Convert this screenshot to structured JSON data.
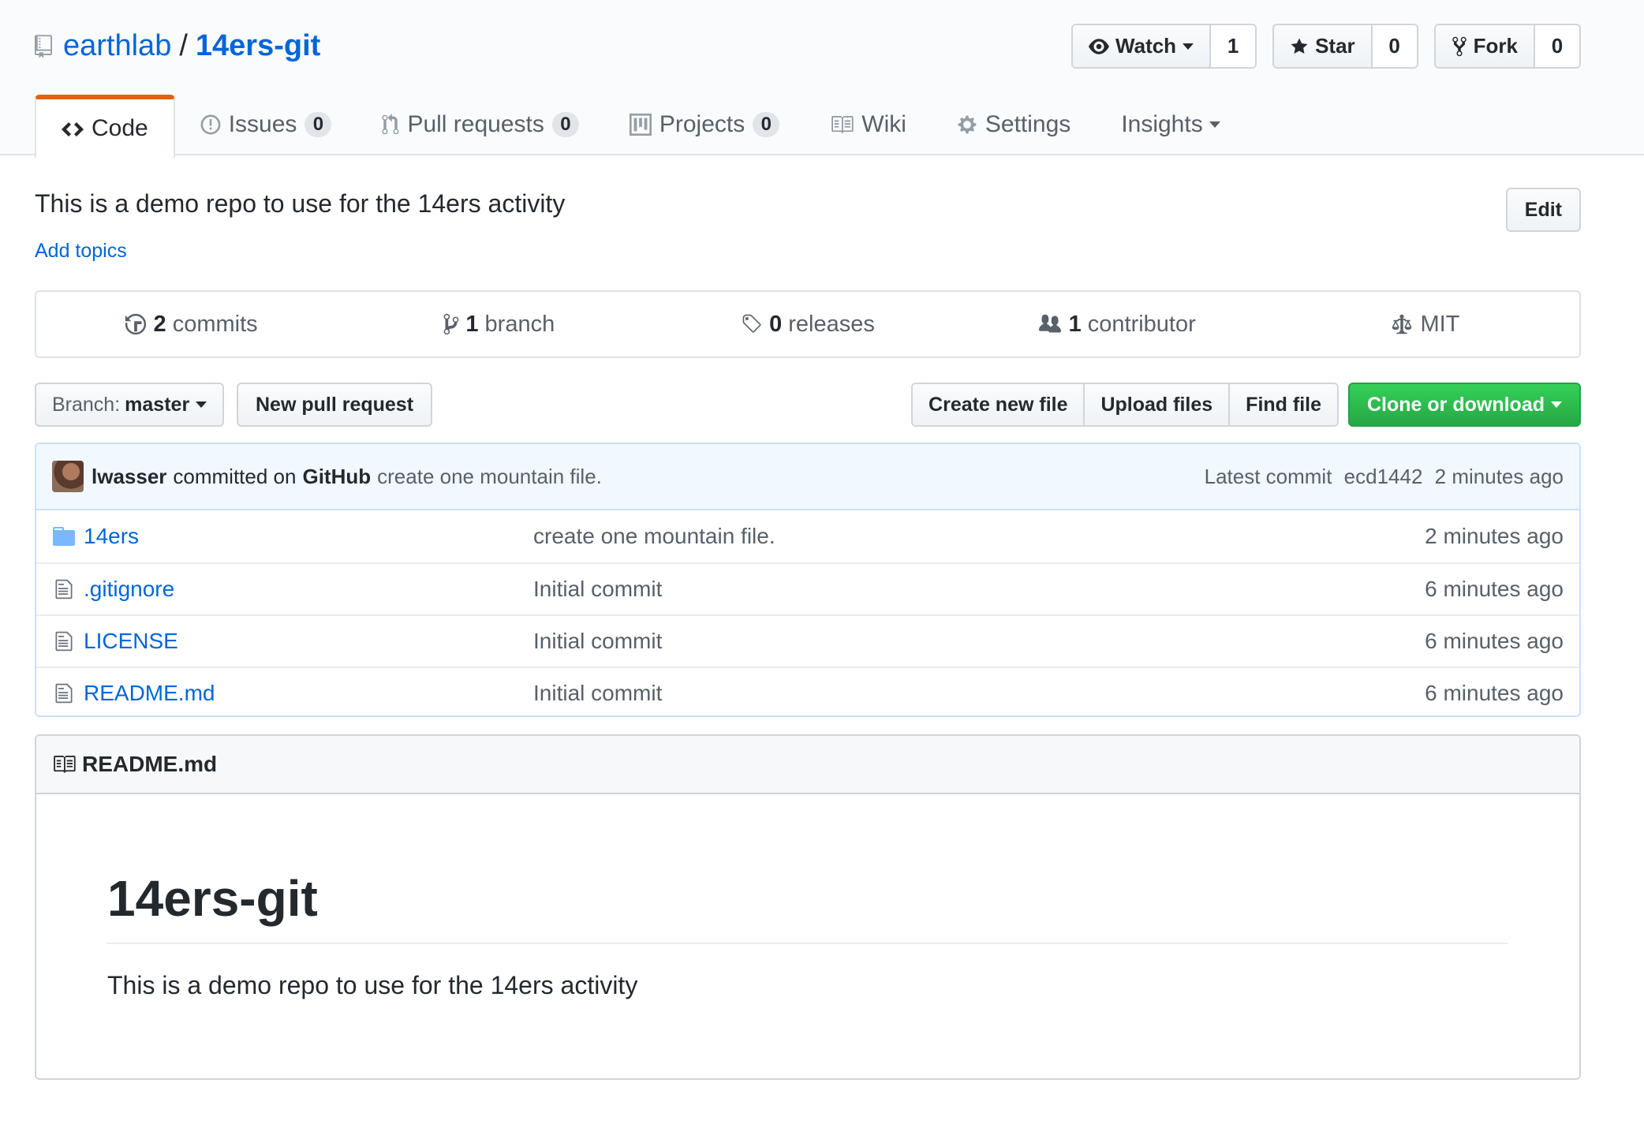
{
  "repo": {
    "owner": "earthlab",
    "separator": "/",
    "name": "14ers-git"
  },
  "actions": {
    "watch_label": "Watch",
    "watch_count": "1",
    "star_label": "Star",
    "star_count": "0",
    "fork_label": "Fork",
    "fork_count": "0"
  },
  "nav": {
    "code": "Code",
    "issues": "Issues",
    "issues_count": "0",
    "pulls": "Pull requests",
    "pulls_count": "0",
    "projects": "Projects",
    "projects_count": "0",
    "wiki": "Wiki",
    "settings": "Settings",
    "insights": "Insights"
  },
  "description": "This is a demo repo to use for the 14ers activity",
  "add_topics": "Add topics",
  "edit_label": "Edit",
  "summary": {
    "commits_num": "2",
    "commits_label": "commits",
    "branch_num": "1",
    "branch_label": "branch",
    "releases_num": "0",
    "releases_label": "releases",
    "contributor_num": "1",
    "contributor_label": "contributor",
    "license": "MIT"
  },
  "branch": {
    "prefix": "Branch:",
    "name": "master"
  },
  "new_pr_label": "New pull request",
  "file_actions": {
    "create": "Create new file",
    "upload": "Upload files",
    "find": "Find file",
    "clone": "Clone or download"
  },
  "commit": {
    "author": "lwasser",
    "committed_on": "committed on",
    "platform": "GitHub",
    "message": "create one mountain file.",
    "latest_label": "Latest commit",
    "sha": "ecd1442",
    "age": "2 minutes ago"
  },
  "files": [
    {
      "name": "14ers",
      "message": "create one mountain file.",
      "age": "2 minutes ago",
      "icon": "folder-icon"
    },
    {
      "name": ".gitignore",
      "message": "Initial commit",
      "age": "6 minutes ago",
      "icon": "file-icon"
    },
    {
      "name": "LICENSE",
      "message": "Initial commit",
      "age": "6 minutes ago",
      "icon": "file-icon"
    },
    {
      "name": "README.md",
      "message": "Initial commit",
      "age": "6 minutes ago",
      "icon": "file-icon"
    }
  ],
  "readme": {
    "filename": "README.md",
    "heading": "14ers-git",
    "body": "This is a demo repo to use for the 14ers activity"
  },
  "colors": {
    "link": "#0366d6",
    "nav_accent": "#e36209",
    "clone_green": "#28a745",
    "commit_bg": "#f1f8ff"
  }
}
